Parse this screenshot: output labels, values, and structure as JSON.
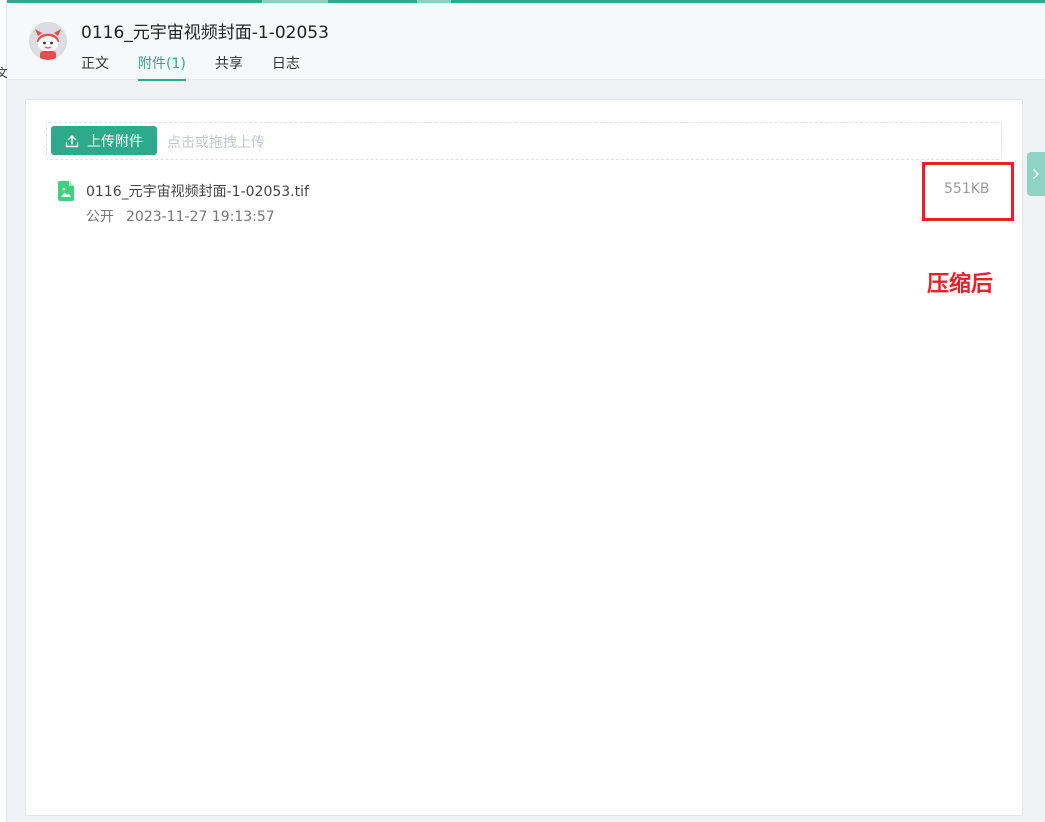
{
  "header": {
    "title": "0116_元宇宙视频封面-1-02053",
    "tabs": [
      {
        "label": "正文"
      },
      {
        "label": "附件(1)"
      },
      {
        "label": "共享"
      },
      {
        "label": "日志"
      }
    ],
    "active_tab": 1
  },
  "upload": {
    "button_label": "上传附件",
    "hint": "点击或拖拽上传"
  },
  "attachments": [
    {
      "name": "0116_元宇宙视频封面-1-02053.tif",
      "visibility": "公开",
      "timestamp": "2023-11-27 19:13:57",
      "size": "551KB"
    }
  ],
  "annotation": {
    "label": "压缩后"
  },
  "colors": {
    "accent": "#2ea98c",
    "annotation_red": "#e8202a",
    "file_icon_green": "#3ed17f"
  },
  "icons": {
    "upload": "upload-icon",
    "file": "image-file-icon",
    "handle": "chevron-right-icon"
  }
}
